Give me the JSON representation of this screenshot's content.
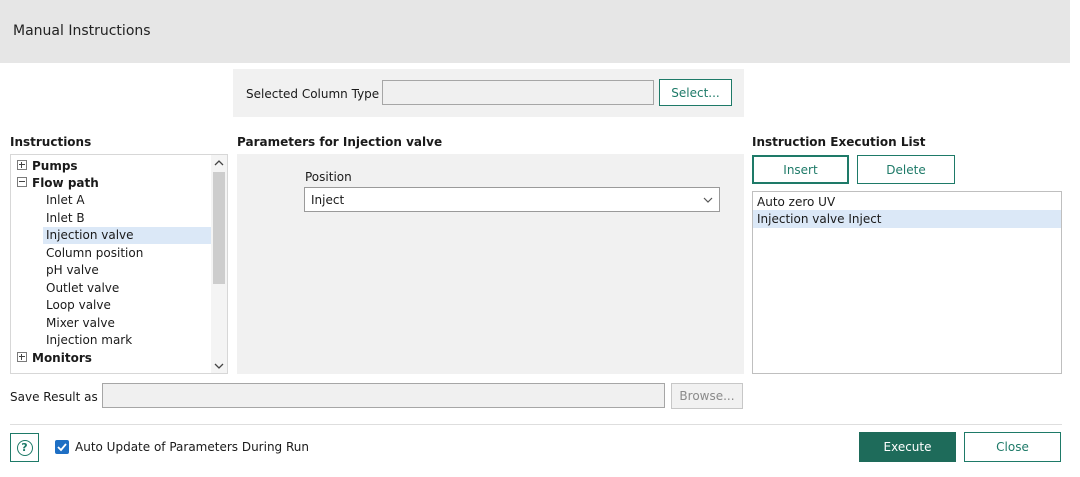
{
  "dialog": {
    "title": "Manual Instructions"
  },
  "column": {
    "label": "Selected Column Type",
    "value": "",
    "select_label": "Select..."
  },
  "instructions": {
    "heading": "Instructions",
    "tree": [
      {
        "label": "Pumps",
        "bold": true,
        "expander": "plus"
      },
      {
        "label": "Flow path",
        "bold": true,
        "expander": "minus"
      },
      {
        "label": "Inlet A"
      },
      {
        "label": "Inlet B"
      },
      {
        "label": "Injection valve",
        "selected": true
      },
      {
        "label": "Column position"
      },
      {
        "label": "pH valve"
      },
      {
        "label": "Outlet valve"
      },
      {
        "label": "Loop valve"
      },
      {
        "label": "Mixer valve"
      },
      {
        "label": "Injection mark"
      },
      {
        "label": "Monitors",
        "bold": true,
        "expander": "plus"
      }
    ]
  },
  "parameters": {
    "heading": "Parameters for Injection valve",
    "position_label": "Position",
    "position_value": "Inject"
  },
  "execution": {
    "heading": "Instruction Execution List",
    "insert_label": "Insert",
    "delete_label": "Delete",
    "items": [
      {
        "label": "Auto zero UV",
        "selected": false
      },
      {
        "label": "Injection valve Inject",
        "selected": true
      }
    ]
  },
  "save": {
    "label": "Save Result as",
    "value": "",
    "browse_label": "Browse..."
  },
  "footer": {
    "auto_update_label": "Auto Update of Parameters During Run",
    "auto_update_checked": true,
    "help_glyph": "?",
    "execute_label": "Execute",
    "close_label": "Close"
  },
  "colors": {
    "accent": "#1e7a68",
    "primary": "#1e6b5a",
    "selection": "#dbe8f7",
    "checkbox": "#1e6fc4"
  }
}
